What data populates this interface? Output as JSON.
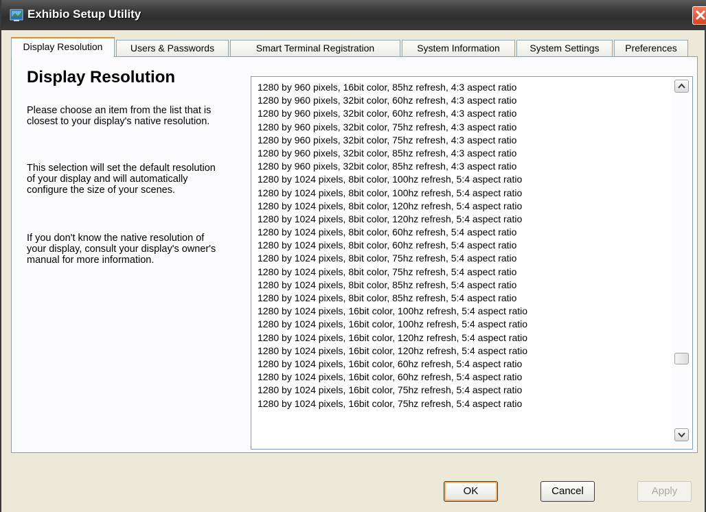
{
  "window": {
    "title": "Exhibio Setup Utility",
    "close_icon": "close-icon",
    "app_icon": "exhibio-app-icon"
  },
  "tabs": [
    {
      "label": "Display Resolution",
      "active": true
    },
    {
      "label": "Users & Passwords",
      "active": false
    },
    {
      "label": "Smart Terminal Registration",
      "active": false
    },
    {
      "label": "System Information",
      "active": false
    },
    {
      "label": "System Settings",
      "active": false
    },
    {
      "label": "Preferences",
      "active": false
    }
  ],
  "panel": {
    "title": "Display Resolution",
    "paragraphs": [
      "Please choose an item from the list that is closest to your display's native resolution.",
      "This selection will set the default resolution of your display and will automatically configure the size of your scenes.",
      "If you don't know the native resolution of your display, consult your display's owner's manual for more information."
    ]
  },
  "resolution_list": {
    "items": [
      "1280 by 960 pixels, 16bit color, 85hz refresh, 4:3 aspect ratio",
      "1280 by 960 pixels, 32bit color, 60hz refresh, 4:3 aspect ratio",
      "1280 by 960 pixels, 32bit color, 60hz refresh, 4:3 aspect ratio",
      "1280 by 960 pixels, 32bit color, 75hz refresh, 4:3 aspect ratio",
      "1280 by 960 pixels, 32bit color, 75hz refresh, 4:3 aspect ratio",
      "1280 by 960 pixels, 32bit color, 85hz refresh, 4:3 aspect ratio",
      "1280 by 960 pixels, 32bit color, 85hz refresh, 4:3 aspect ratio",
      "1280 by 1024 pixels, 8bit color, 100hz refresh, 5:4 aspect ratio",
      "1280 by 1024 pixels, 8bit color, 100hz refresh, 5:4 aspect ratio",
      "1280 by 1024 pixels, 8bit color, 120hz refresh, 5:4 aspect ratio",
      "1280 by 1024 pixels, 8bit color, 120hz refresh, 5:4 aspect ratio",
      "1280 by 1024 pixels, 8bit color, 60hz refresh, 5:4 aspect ratio",
      "1280 by 1024 pixels, 8bit color, 60hz refresh, 5:4 aspect ratio",
      "1280 by 1024 pixels, 8bit color, 75hz refresh, 5:4 aspect ratio",
      "1280 by 1024 pixels, 8bit color, 75hz refresh, 5:4 aspect ratio",
      "1280 by 1024 pixels, 8bit color, 85hz refresh, 5:4 aspect ratio",
      "1280 by 1024 pixels, 8bit color, 85hz refresh, 5:4 aspect ratio",
      "1280 by 1024 pixels, 16bit color, 100hz refresh, 5:4 aspect ratio",
      "1280 by 1024 pixels, 16bit color, 100hz refresh, 5:4 aspect ratio",
      "1280 by 1024 pixels, 16bit color, 120hz refresh, 5:4 aspect ratio",
      "1280 by 1024 pixels, 16bit color, 120hz refresh, 5:4 aspect ratio",
      "1280 by 1024 pixels, 16bit color, 60hz refresh, 5:4 aspect ratio",
      "1280 by 1024 pixels, 16bit color, 60hz refresh, 5:4 aspect ratio",
      "1280 by 1024 pixels, 16bit color, 75hz refresh, 5:4 aspect ratio",
      "1280 by 1024 pixels, 16bit color, 75hz refresh, 5:4 aspect ratio"
    ],
    "scroll_position": 0.75
  },
  "buttons": {
    "ok": "OK",
    "cancel": "Cancel",
    "apply": "Apply"
  },
  "colors": {
    "titlebar": "#3e3e3e",
    "close_button": "#e2532f",
    "active_tab_accent": "#e68b2c",
    "dialog_background": "#ece9d8",
    "list_border": "#7f9db9"
  }
}
